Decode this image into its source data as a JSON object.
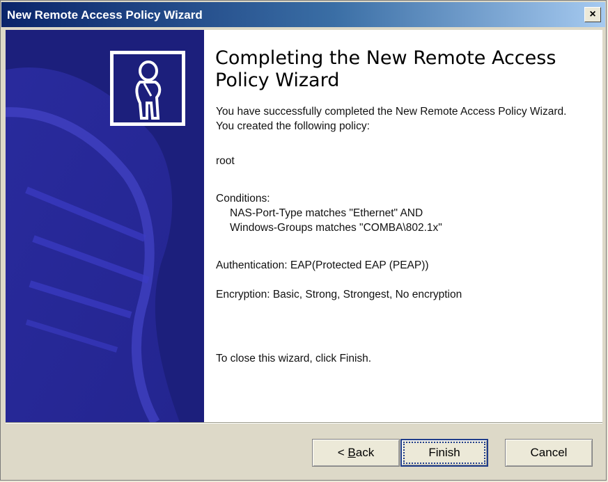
{
  "window": {
    "title": "New Remote Access Policy Wizard",
    "close_symbol": "×"
  },
  "content": {
    "heading": "Completing the New Remote Access Policy Wizard",
    "intro": "You have successfully completed the New Remote Access Policy Wizard. You created the following policy:",
    "policy_name": "root",
    "conditions_label": "Conditions:",
    "condition_1": "NAS-Port-Type matches \"Ethernet\" AND",
    "condition_2": "Windows-Groups matches \"COMBA\\802.1x\"",
    "authentication": "Authentication: EAP(Protected EAP (PEAP))",
    "encryption": "Encryption: Basic, Strong, Strongest, No encryption",
    "closing": "To close this wizard, click Finish."
  },
  "buttons": {
    "back_prefix": "< ",
    "back_mnemonic": "B",
    "back_rest": "ack",
    "finish": "Finish",
    "cancel": "Cancel"
  },
  "icons": {
    "close": "close-icon",
    "wizard_person": "person-icon"
  },
  "colors": {
    "title_gradient_start": "#0a246a",
    "title_gradient_end": "#a6caf0",
    "side_panel": "#1c1f7c"
  }
}
